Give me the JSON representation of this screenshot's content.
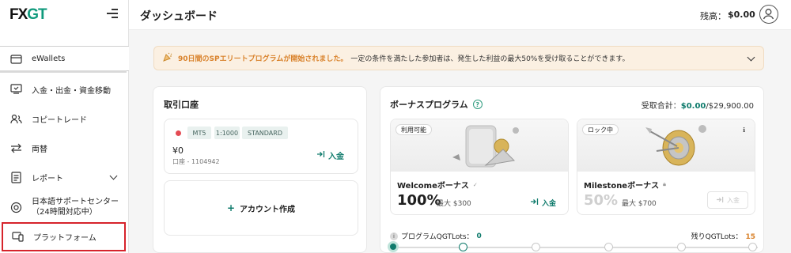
{
  "brand": {
    "logo_fx": "FX",
    "logo_gt": "GT"
  },
  "header": {
    "title": "ダッシュボード",
    "balance_label": "残高：",
    "balance_value": "$0.00"
  },
  "sidebar": {
    "items": [
      {
        "label": "eWallets",
        "icon": "wallet-icon"
      },
      {
        "label": "入金・出金・資金移動",
        "icon": "transfer-icon"
      },
      {
        "label": "コピートレード",
        "icon": "users-icon"
      },
      {
        "label": "両替",
        "icon": "exchange-icon"
      },
      {
        "label": "レポート",
        "icon": "report-icon"
      },
      {
        "label_line1": "日本語サポートセンター",
        "label_line2": "（24時間対応中）",
        "icon": "support-icon"
      },
      {
        "label": "プラットフォーム",
        "icon": "platform-icon"
      }
    ]
  },
  "banner": {
    "highlight": "90日間のSPエリートプログラムが開始されました。",
    "text": "一定の条件を満たした参加者は、発生した利益の最大50%を受け取ることができます。"
  },
  "accounts": {
    "title": "取引口座",
    "account": {
      "tags": [
        "MT5",
        "1:1000",
        "STANDARD"
      ],
      "balance": "¥0",
      "number": "口座 - 1104942",
      "deposit_label": "入金"
    },
    "create_label": "アカウント作成"
  },
  "bonus": {
    "title": "ボーナスプログラム",
    "total_label": "受取合計：",
    "total_received": "$0.00",
    "total_max": "/$29,900.00",
    "cards": [
      {
        "badge": "利用可能",
        "name": "Welcomeボーナス",
        "percent": "100%",
        "max": "最大 $300",
        "action": "入金",
        "enabled": true
      },
      {
        "badge": "ロック中",
        "name": "Milestoneボーナス",
        "percent": "50%",
        "max": "最大 $700",
        "action": "入金",
        "enabled": false
      }
    ],
    "progress": {
      "label": "プログラムQGTLots：",
      "value": "0",
      "remain_label": "残りQGTLots：",
      "remain_value": "15"
    }
  },
  "colors": {
    "accent": "#0f7b6c",
    "warning": "#d9822b",
    "highlight_border": "#d6232b"
  }
}
